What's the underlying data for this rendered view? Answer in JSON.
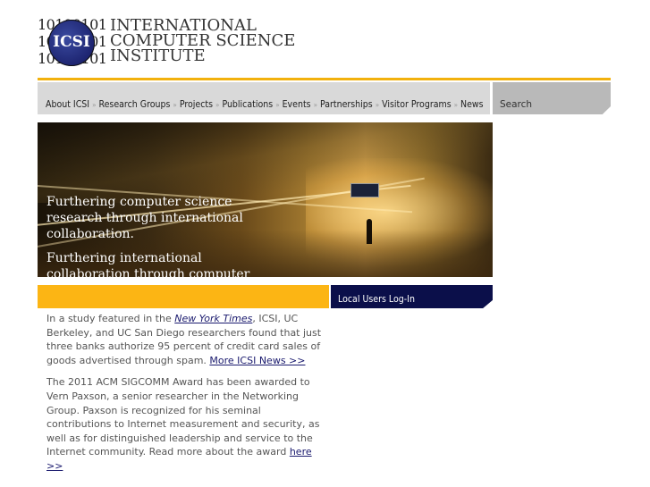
{
  "logo": {
    "bits": [
      "10100101",
      "10100101",
      "10100101"
    ],
    "abbr": "ICSI",
    "name_lines": [
      "INTERNATIONAL",
      "COMPUTER SCIENCE",
      "INSTITUTE"
    ]
  },
  "nav": {
    "items": [
      "About ICSI",
      "Research Groups",
      "Projects",
      "Publications",
      "Events",
      "Partnerships",
      "Visitor Programs",
      "News"
    ],
    "separator": "»"
  },
  "search": {
    "placeholder": "Search"
  },
  "hero": {
    "tagline1": "Furthering computer science research through international collaboration.",
    "tagline2": "Furthering international collaboration through computer science research."
  },
  "login": {
    "label": "Local Users Log-In"
  },
  "news": [
    {
      "pre": "In a study featured in the ",
      "link1": "New York Times",
      "mid": ", ICSI, UC Berkeley, and UC San Diego researchers found that just three banks authorize 95 percent of credit card sales of goods advertised through spam. ",
      "link2": "More ICSI News >>"
    },
    {
      "pre": "The 2011 ACM SIGCOMM Award has been awarded to Vern Paxson, a senior researcher in the Networking Group. Paxson is recognized for his seminal contributions to Internet measurement and security, as well as for distinguished leadership and service to the Internet community. Read more about the award ",
      "link": "here >>"
    }
  ],
  "colors": {
    "accent": "#fcb514",
    "login_bg": "#0b0f4a",
    "nav_bg": "#d9d9d9",
    "search_bg": "#b9b9b9"
  }
}
